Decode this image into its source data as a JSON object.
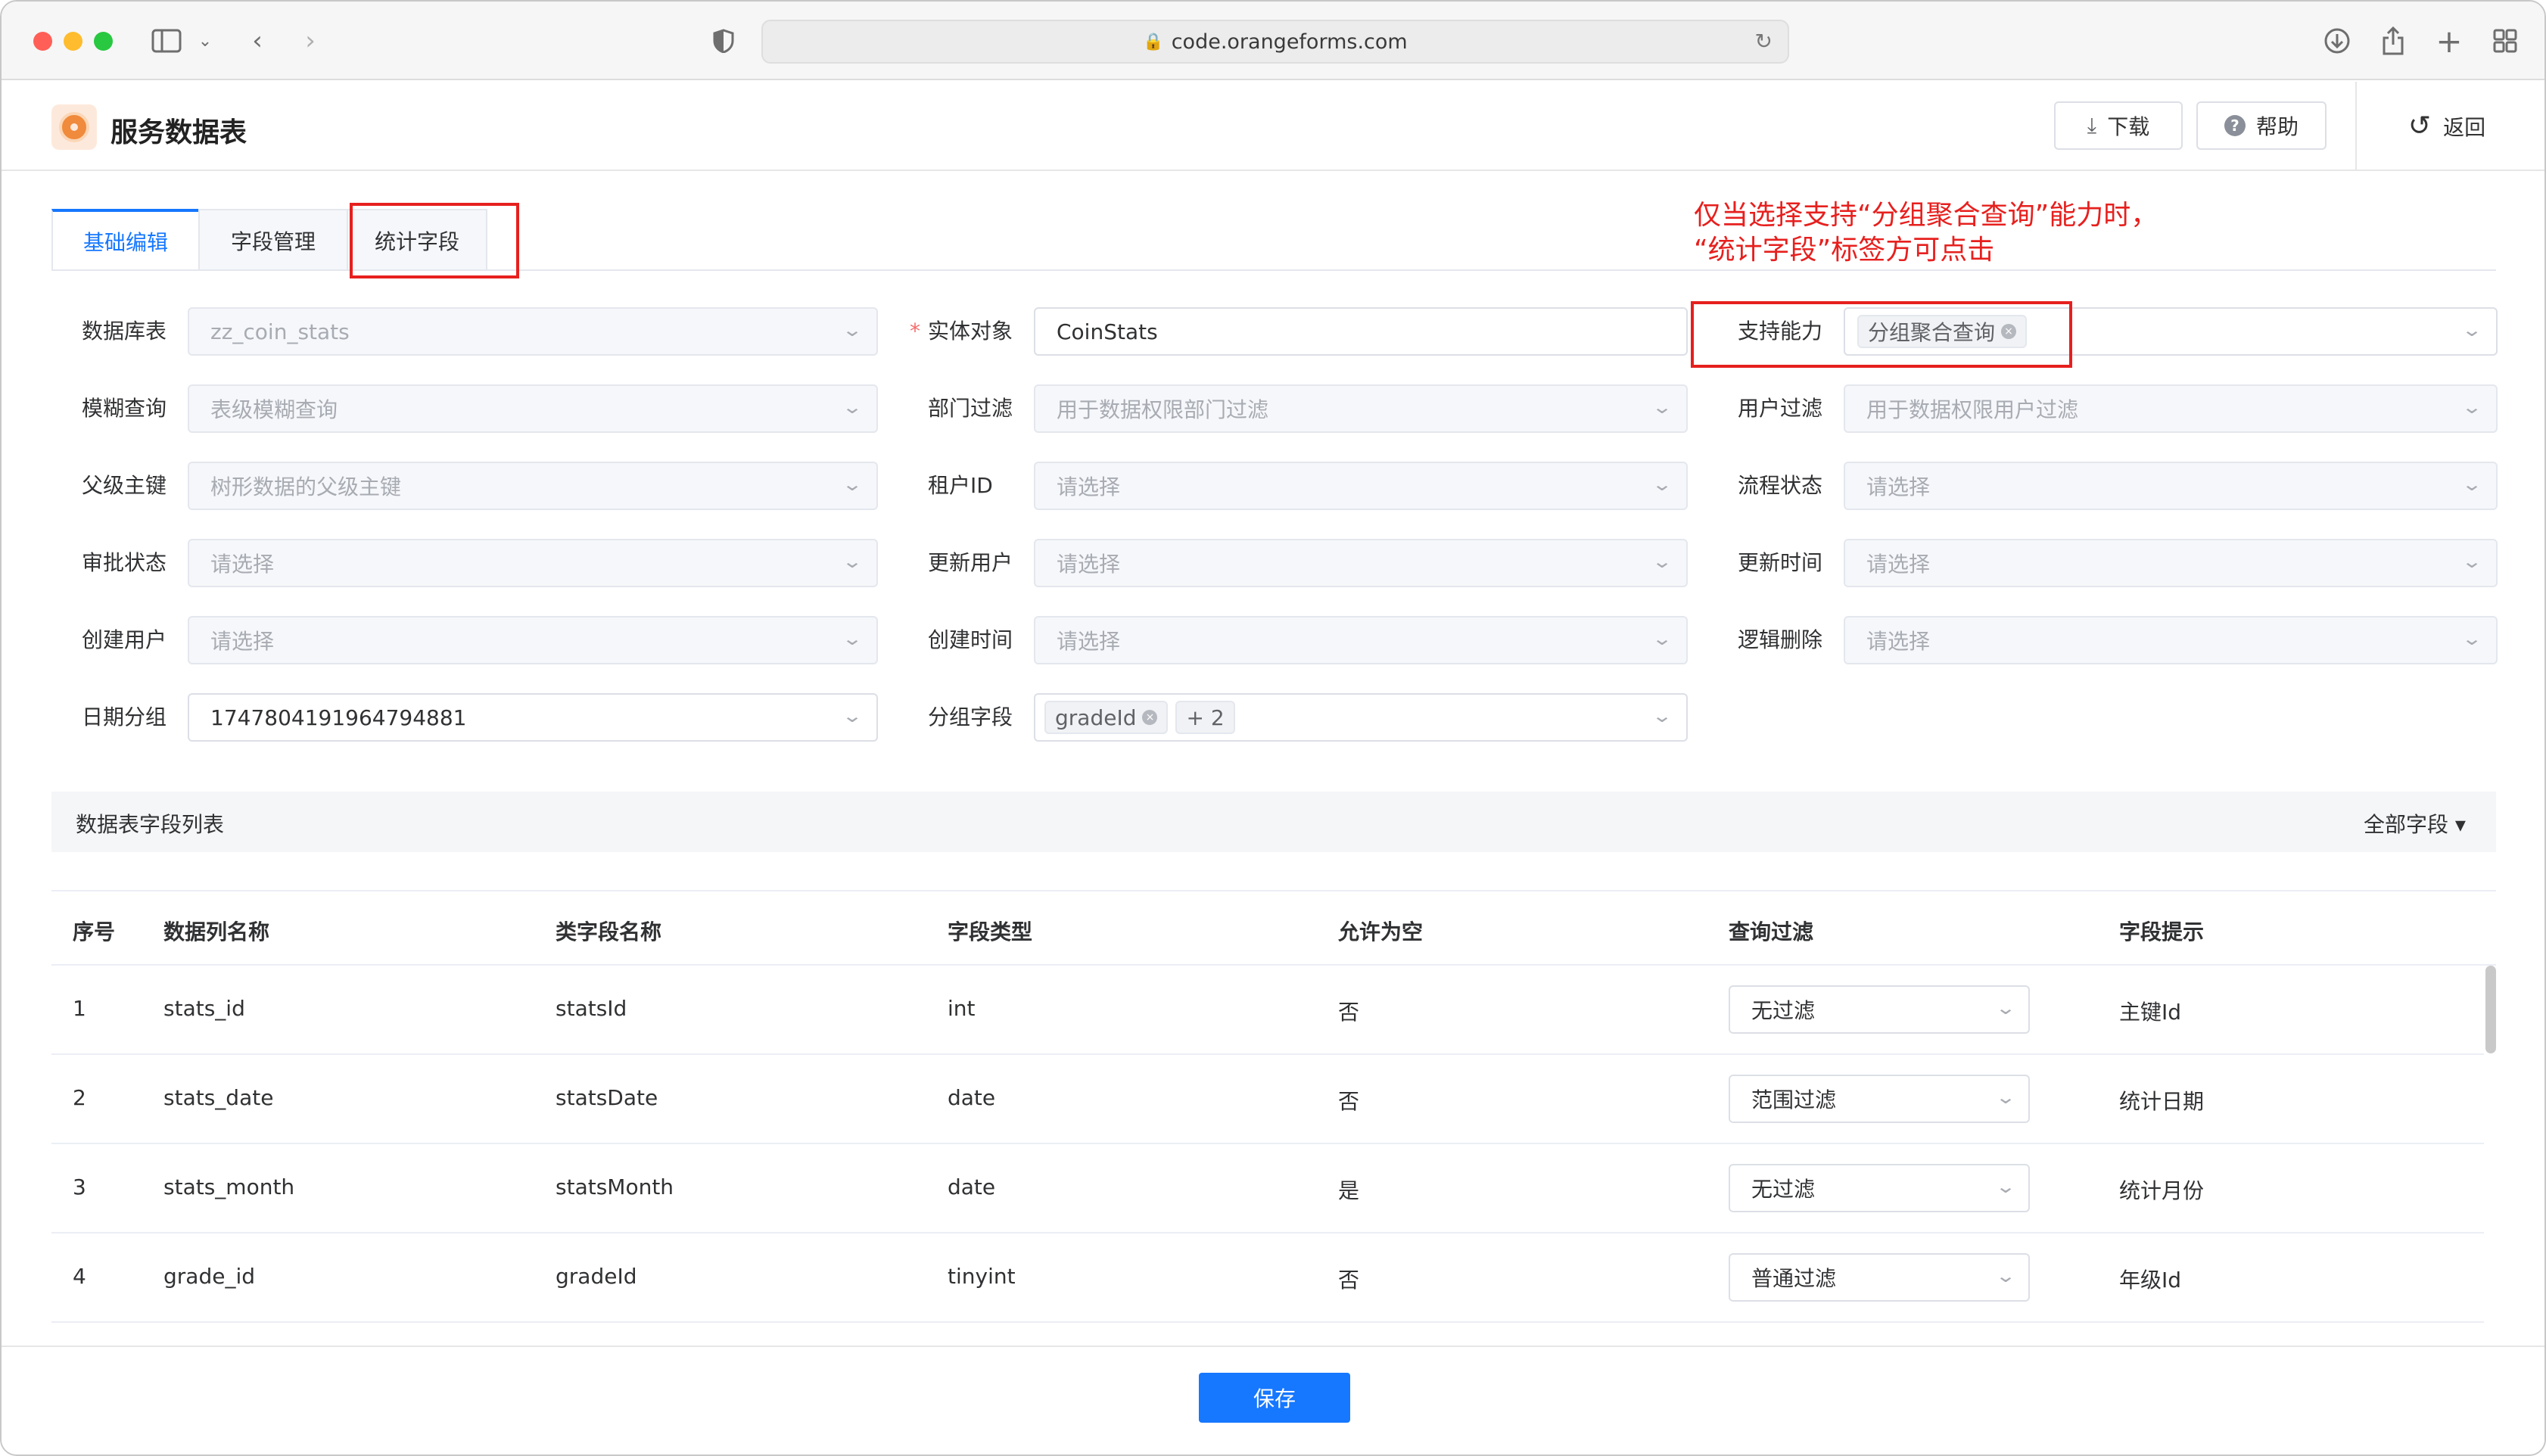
{
  "browser": {
    "url": "code.orangeforms.com"
  },
  "header": {
    "title": "服务数据表",
    "download_label": "下载",
    "help_label": "帮助",
    "back_label": "返回"
  },
  "tabs": [
    {
      "label": "基础编辑"
    },
    {
      "label": "字段管理"
    },
    {
      "label": "统计字段"
    }
  ],
  "annotation": {
    "line1": "仅当选择支持“分组聚合查询”能力时，",
    "line2": "“统计字段”标签方可点击"
  },
  "form": {
    "database_table": {
      "label": "数据库表",
      "value": "zz_coin_stats"
    },
    "entity_object": {
      "label": "实体对象",
      "value": "CoinStats"
    },
    "support_ability": {
      "label": "支持能力",
      "tag": "分组聚合查询"
    },
    "fuzzy_query": {
      "label": "模糊查询",
      "placeholder": "表级模糊查询"
    },
    "dept_filter": {
      "label": "部门过滤",
      "placeholder": "用于数据权限部门过滤"
    },
    "user_filter": {
      "label": "用户过滤",
      "placeholder": "用于数据权限用户过滤"
    },
    "parent_key": {
      "label": "父级主键",
      "placeholder": "树形数据的父级主键"
    },
    "tenant_id": {
      "label": "租户ID",
      "placeholder": "请选择"
    },
    "flow_status": {
      "label": "流程状态",
      "placeholder": "请选择"
    },
    "approval_status": {
      "label": "审批状态",
      "placeholder": "请选择"
    },
    "update_user": {
      "label": "更新用户",
      "placeholder": "请选择"
    },
    "update_time": {
      "label": "更新时间",
      "placeholder": "请选择"
    },
    "create_user": {
      "label": "创建用户",
      "placeholder": "请选择"
    },
    "create_time": {
      "label": "创建时间",
      "placeholder": "请选择"
    },
    "logic_delete": {
      "label": "逻辑删除",
      "placeholder": "请选择"
    },
    "date_group": {
      "label": "日期分组",
      "value": "1747804191964794881"
    },
    "group_field": {
      "label": "分组字段",
      "tag": "gradeId",
      "more": "+ 2"
    }
  },
  "section": {
    "title": "数据表字段列表",
    "filter": "全部字段 ▾"
  },
  "table": {
    "columns": [
      "序号",
      "数据列名称",
      "类字段名称",
      "字段类型",
      "允许为空",
      "查询过滤",
      "字段提示"
    ],
    "rows": [
      {
        "no": "1",
        "column": "stats_id",
        "field": "statsId",
        "type": "int",
        "nullable": "否",
        "filter": "无过滤",
        "hint": "主键Id"
      },
      {
        "no": "2",
        "column": "stats_date",
        "field": "statsDate",
        "type": "date",
        "nullable": "否",
        "filter": "范围过滤",
        "hint": "统计日期"
      },
      {
        "no": "3",
        "column": "stats_month",
        "field": "statsMonth",
        "type": "date",
        "nullable": "是",
        "filter": "无过滤",
        "hint": "统计月份"
      },
      {
        "no": "4",
        "column": "grade_id",
        "field": "gradeId",
        "type": "tinyint",
        "nullable": "否",
        "filter": "普通过滤",
        "hint": "年级Id"
      }
    ]
  },
  "footer": {
    "save_label": "保存"
  }
}
